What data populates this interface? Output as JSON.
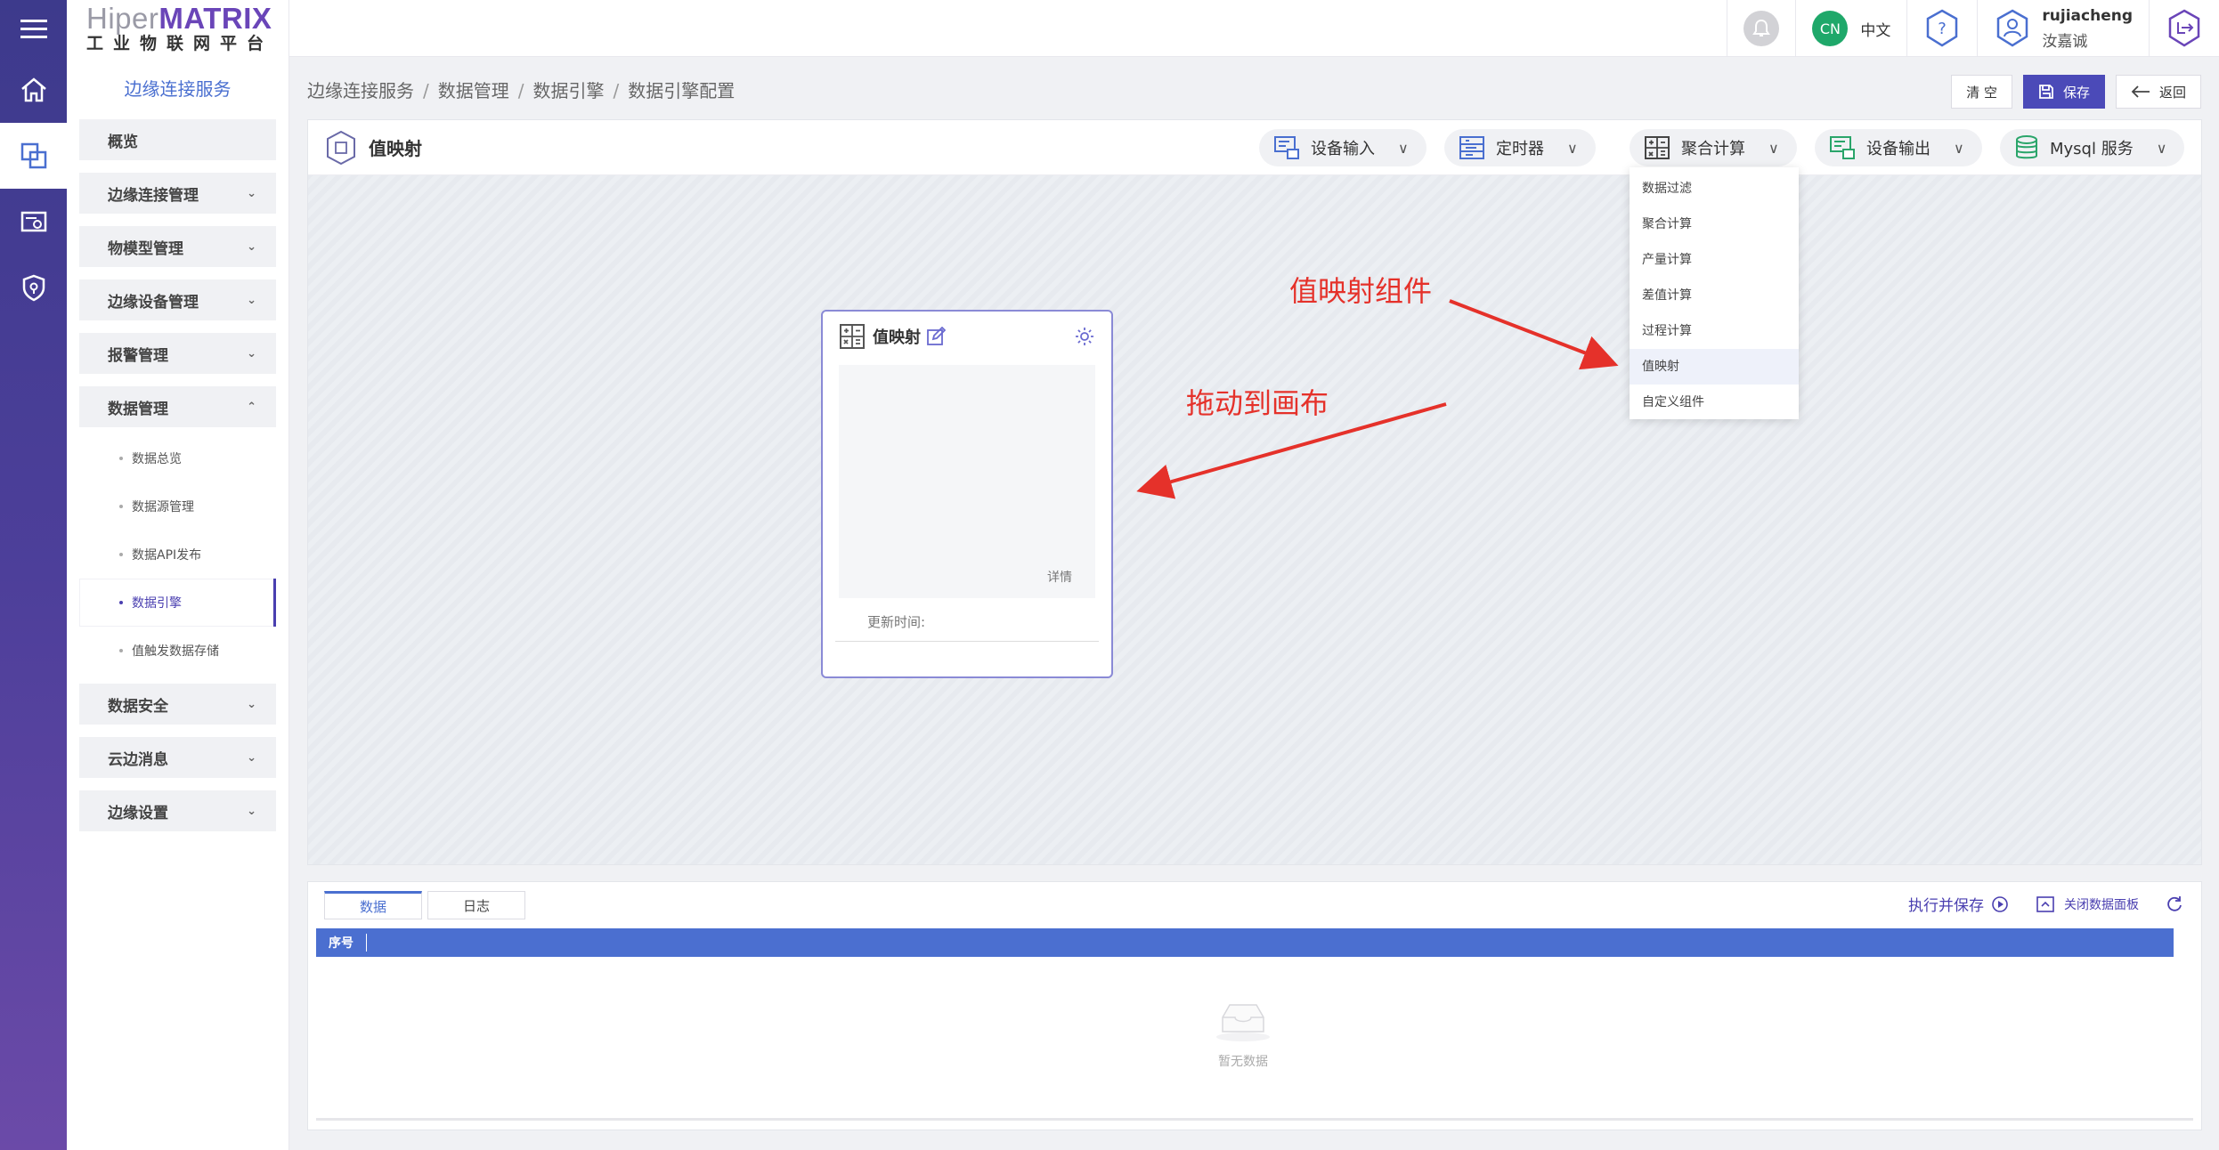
{
  "brand": {
    "part1": "Hiper",
    "part2": "MATRIX",
    "subtitle": "工业物联网平台"
  },
  "sidebar": {
    "service_title": "边缘连接服务",
    "groups": [
      {
        "label": "概览"
      },
      {
        "label": "边缘连接管理",
        "chevron": "⌄"
      },
      {
        "label": "物模型管理",
        "chevron": "⌄"
      },
      {
        "label": "边缘设备管理",
        "chevron": "⌄"
      },
      {
        "label": "报警管理",
        "chevron": "⌄"
      },
      {
        "label": "数据管理",
        "chevron": "⌃"
      },
      {
        "label": "数据安全",
        "chevron": "⌄"
      },
      {
        "label": "云边消息",
        "chevron": "⌄"
      },
      {
        "label": "边缘设置",
        "chevron": "⌄"
      }
    ],
    "data_mgmt_items": [
      {
        "label": "数据总览"
      },
      {
        "label": "数据源管理"
      },
      {
        "label": "数据API发布"
      },
      {
        "label": "数据引擎"
      },
      {
        "label": "值触发数据存储"
      }
    ]
  },
  "topbar": {
    "lang_badge": "CN",
    "lang_label": "中文",
    "username": "rujiacheng",
    "display_name": "汝嘉诚"
  },
  "breadcrumb": [
    "边缘连接服务",
    "数据管理",
    "数据引擎",
    "数据引擎配置"
  ],
  "breadcrumb_sep": "/",
  "actions": {
    "clear": "清 空",
    "save": "保存",
    "back": "返回"
  },
  "editor": {
    "title": "值映射",
    "tools": [
      {
        "label": "设备输入",
        "caret": "∨"
      },
      {
        "label": "定时器",
        "caret": "∨"
      },
      {
        "label": "聚合计算",
        "caret": "∨"
      },
      {
        "label": "设备输出",
        "caret": "∨"
      },
      {
        "label": "Mysql 服务",
        "caret": "∨"
      }
    ],
    "dropdown": [
      "数据过滤",
      "聚合计算",
      "产量计算",
      "差值计算",
      "过程计算",
      "值映射",
      "自定义组件"
    ],
    "node": {
      "title": "值映射",
      "detail": "详情",
      "update_time": "更新时间:"
    }
  },
  "annotations": {
    "component": "值映射组件",
    "drag": "拖动到画布"
  },
  "data_panel": {
    "tabs": [
      "数据",
      "日志"
    ],
    "run_save": "执行并保存",
    "close_panel": "关闭数据面板",
    "column": "序号",
    "empty": "暂无数据"
  },
  "colors": {
    "accent": "#4b4ab8",
    "rail": "#4d3f9a",
    "annotation": "#e5312a",
    "table_head": "#4b6fd0"
  }
}
